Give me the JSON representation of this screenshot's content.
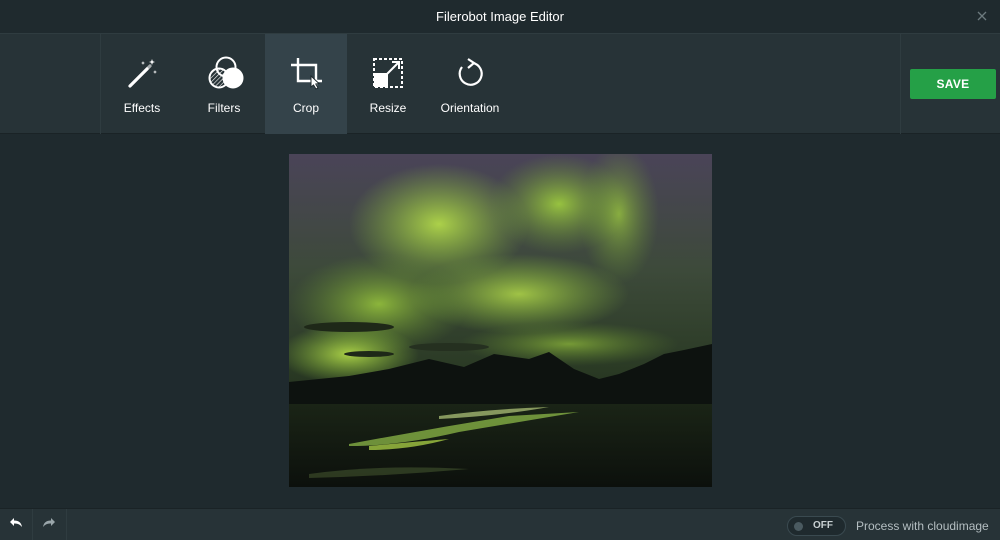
{
  "window": {
    "title": "Filerobot Image Editor"
  },
  "toolbar": {
    "tools": [
      {
        "label": "Effects",
        "icon": "magic-wand-icon"
      },
      {
        "label": "Filters",
        "icon": "filters-circles-icon"
      },
      {
        "label": "Crop",
        "icon": "crop-icon",
        "active": true
      },
      {
        "label": "Resize",
        "icon": "resize-icon"
      },
      {
        "label": "Orientation",
        "icon": "rotate-icon"
      }
    ],
    "save_label": "SAVE"
  },
  "footer": {
    "undo_icon": "undo-icon",
    "redo_icon": "redo-icon",
    "toggle_state": "OFF",
    "process_label": "Process with cloudimage"
  },
  "colors": {
    "background": "#1f2a2e",
    "toolbar": "#273337",
    "active_tool": "#34434a",
    "save_button": "#25a047"
  }
}
